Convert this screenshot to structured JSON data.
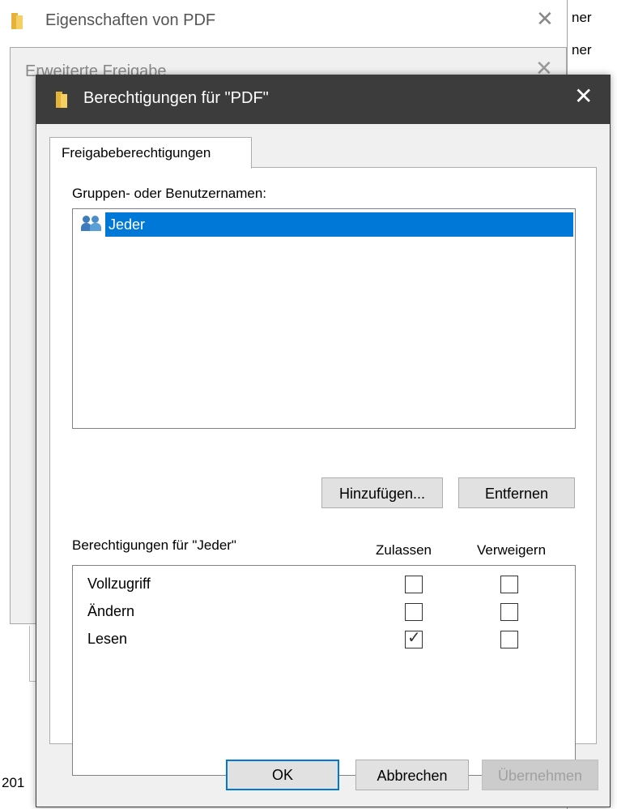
{
  "background": {
    "win1_title": "Eigenschaften von PDF",
    "win2_title": "Erweiterte Freigabe",
    "right_edge_1": "ner",
    "right_edge_2": "ner",
    "bottom_left": "201"
  },
  "dialog": {
    "title": "Berechtigungen für \"PDF\"",
    "close_glyph": "✕",
    "tab_label": "Freigabeberechtigungen",
    "groups_label": "Gruppen- oder Benutzernamen:",
    "users": [
      {
        "name": "Jeder",
        "selected": true
      }
    ],
    "add_button": "Hinzufügen...",
    "remove_button": "Entfernen",
    "permissions_label": "Berechtigungen für \"Jeder\"",
    "col_allow": "Zulassen",
    "col_deny": "Verweigern",
    "permissions": [
      {
        "name": "Vollzugriff",
        "allow": false,
        "deny": false
      },
      {
        "name": "Ändern",
        "allow": false,
        "deny": false
      },
      {
        "name": "Lesen",
        "allow": true,
        "deny": false
      }
    ],
    "ok_button": "OK",
    "cancel_button": "Abbrechen",
    "apply_button": "Übernehmen"
  },
  "colors": {
    "titlebar": "#3c3c3c",
    "selection": "#0078d7",
    "default_button_border": "#0078d7"
  }
}
